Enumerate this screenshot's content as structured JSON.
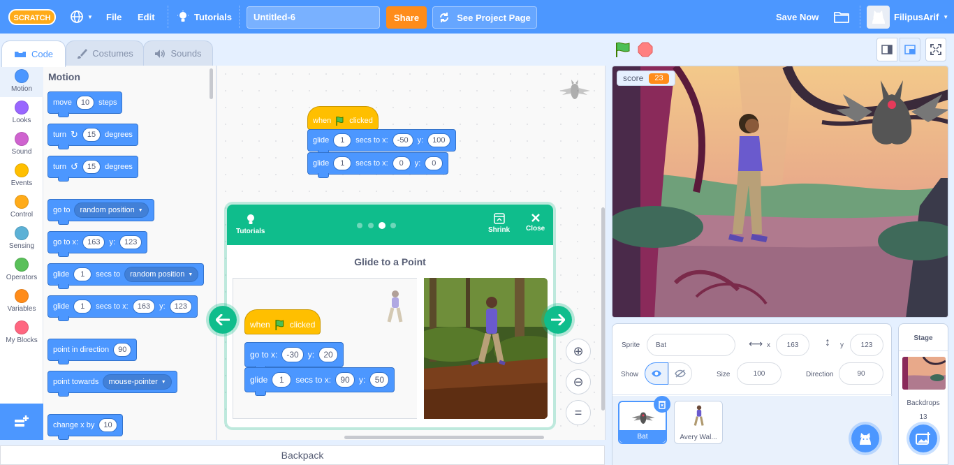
{
  "menubar": {
    "logo_text": "SCRATCH",
    "file": "File",
    "edit": "Edit",
    "tutorials": "Tutorials",
    "project_title": "Untitled-6",
    "share": "Share",
    "see_project_page": "See Project Page",
    "save_now": "Save Now",
    "username": "FilipusArif",
    "accent": "#4c97ff"
  },
  "tabs": [
    {
      "label": "Code",
      "icon": "code-icon",
      "active": true
    },
    {
      "label": "Costumes",
      "icon": "brush-icon",
      "active": false
    },
    {
      "label": "Sounds",
      "icon": "speaker-icon",
      "active": false
    }
  ],
  "categories": [
    {
      "label": "Motion",
      "color": "#4c97ff"
    },
    {
      "label": "Looks",
      "color": "#9966ff"
    },
    {
      "label": "Sound",
      "color": "#cf63cf"
    },
    {
      "label": "Events",
      "color": "#ffbf00"
    },
    {
      "label": "Control",
      "color": "#ffab19"
    },
    {
      "label": "Sensing",
      "color": "#5cb1d6"
    },
    {
      "label": "Operators",
      "color": "#59c059"
    },
    {
      "label": "Variables",
      "color": "#ff8c1a"
    },
    {
      "label": "My Blocks",
      "color": "#ff6680"
    }
  ],
  "palette": {
    "heading": "Motion",
    "move": {
      "pre": "move",
      "val": "10",
      "post": "steps"
    },
    "turn_right": {
      "pre": "turn",
      "val": "15",
      "post": "degrees"
    },
    "turn_left": {
      "pre": "turn",
      "val": "15",
      "post": "degrees"
    },
    "goto": {
      "pre": "go to",
      "menu": "random position"
    },
    "gotoxy": {
      "pre": "go to x:",
      "x": "163",
      "ylabel": "y:",
      "y": "123"
    },
    "glide_to": {
      "pre": "glide",
      "val": "1",
      "mid": "secs to",
      "menu": "random position"
    },
    "glide_xy": {
      "pre": "glide",
      "val": "1",
      "mid": "secs to x:",
      "x": "163",
      "ylabel": "y:",
      "y": "123"
    },
    "point_dir": {
      "pre": "point in direction",
      "val": "90"
    },
    "point_towards": {
      "pre": "point towards",
      "menu": "mouse-pointer"
    },
    "change_x": {
      "pre": "change x by",
      "val": "10"
    }
  },
  "script": {
    "hat": {
      "when": "when",
      "clicked": "clicked"
    },
    "glide1": {
      "pre": "glide",
      "val": "1",
      "mid": "secs to x:",
      "x": "-50",
      "ylabel": "y:",
      "y": "100"
    },
    "glide2": {
      "pre": "glide",
      "val": "1",
      "mid": "secs to x:",
      "x": "0",
      "ylabel": "y:",
      "y": "0"
    }
  },
  "tutorial": {
    "tutorials_label": "Tutorials",
    "shrink_label": "Shrink",
    "close_label": "Close",
    "title": "Glide to a Point",
    "step_current": 3,
    "step_total": 4,
    "hat": {
      "when": "when",
      "clicked": "clicked"
    },
    "goto": {
      "pre": "go to x:",
      "x": "-30",
      "ylabel": "y:",
      "y": "20"
    },
    "glide": {
      "pre": "glide",
      "val": "1",
      "mid": "secs to x:",
      "x": "90",
      "ylabel": "y:",
      "y": "50"
    }
  },
  "backpack": "Backpack",
  "stage": {
    "score_label": "score",
    "score_value": "23"
  },
  "sprite_info": {
    "sprite_label": "Sprite",
    "sprite_name": "Bat",
    "x_label": "x",
    "x_value": "163",
    "y_label": "y",
    "y_value": "123",
    "show_label": "Show",
    "size_label": "Size",
    "size_value": "100",
    "direction_label": "Direction",
    "direction_value": "90"
  },
  "sprites": [
    {
      "name": "Bat",
      "selected": true
    },
    {
      "name": "Avery Wal...",
      "selected": false
    }
  ],
  "stage_target": {
    "title": "Stage",
    "backdrops_label": "Backdrops",
    "backdrops_count": "13"
  }
}
